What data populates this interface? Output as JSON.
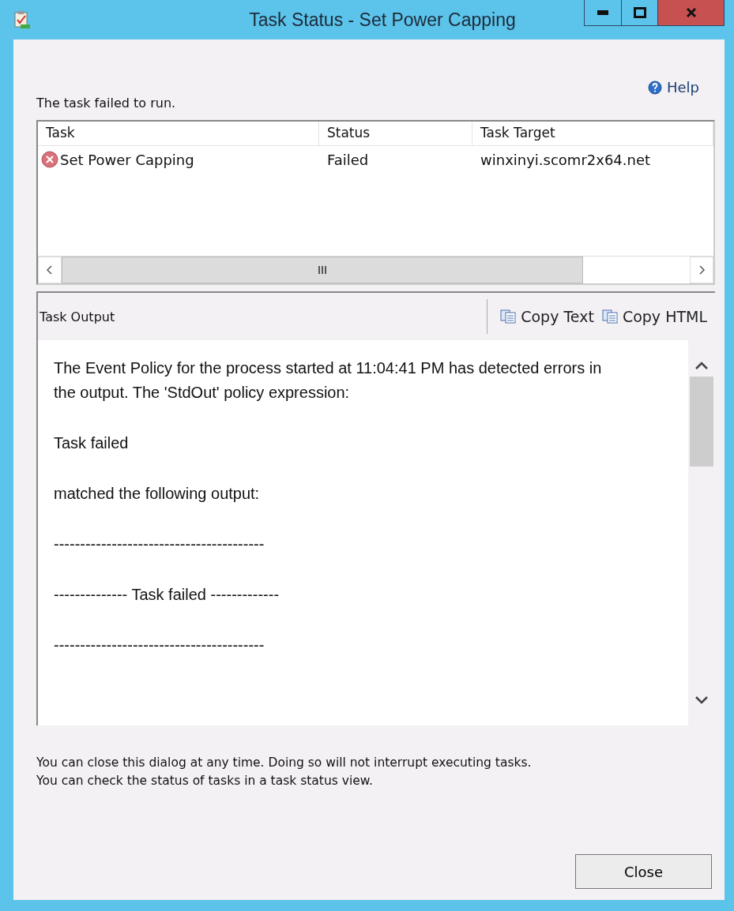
{
  "window": {
    "title": "Task Status - Set Power Capping"
  },
  "help": {
    "label": "Help"
  },
  "summary": "The task failed to run.",
  "table": {
    "columns": [
      "Task",
      "Status",
      "Task Target"
    ],
    "rows": [
      {
        "failed": true,
        "cells": [
          "Set Power Capping",
          "Failed",
          "winxinyi.scomr2x64.net"
        ]
      }
    ]
  },
  "output": {
    "title": "Task Output",
    "actions": [
      "Copy Text",
      "Copy HTML"
    ],
    "lines": [
      "The Event Policy for the process started at 11:04:41 PM has detected errors in the output. The 'StdOut' policy expression:",
      "Task failed",
      "matched the following output:",
      "----------------------------------------",
      "-------------- Task failed -------------",
      "----------------------------------------"
    ]
  },
  "notes": [
    "You can close this dialog at any time. Doing so will not interrupt executing tasks.",
    "You can check the status of tasks in a task status view."
  ],
  "buttons": [
    "Close"
  ]
}
